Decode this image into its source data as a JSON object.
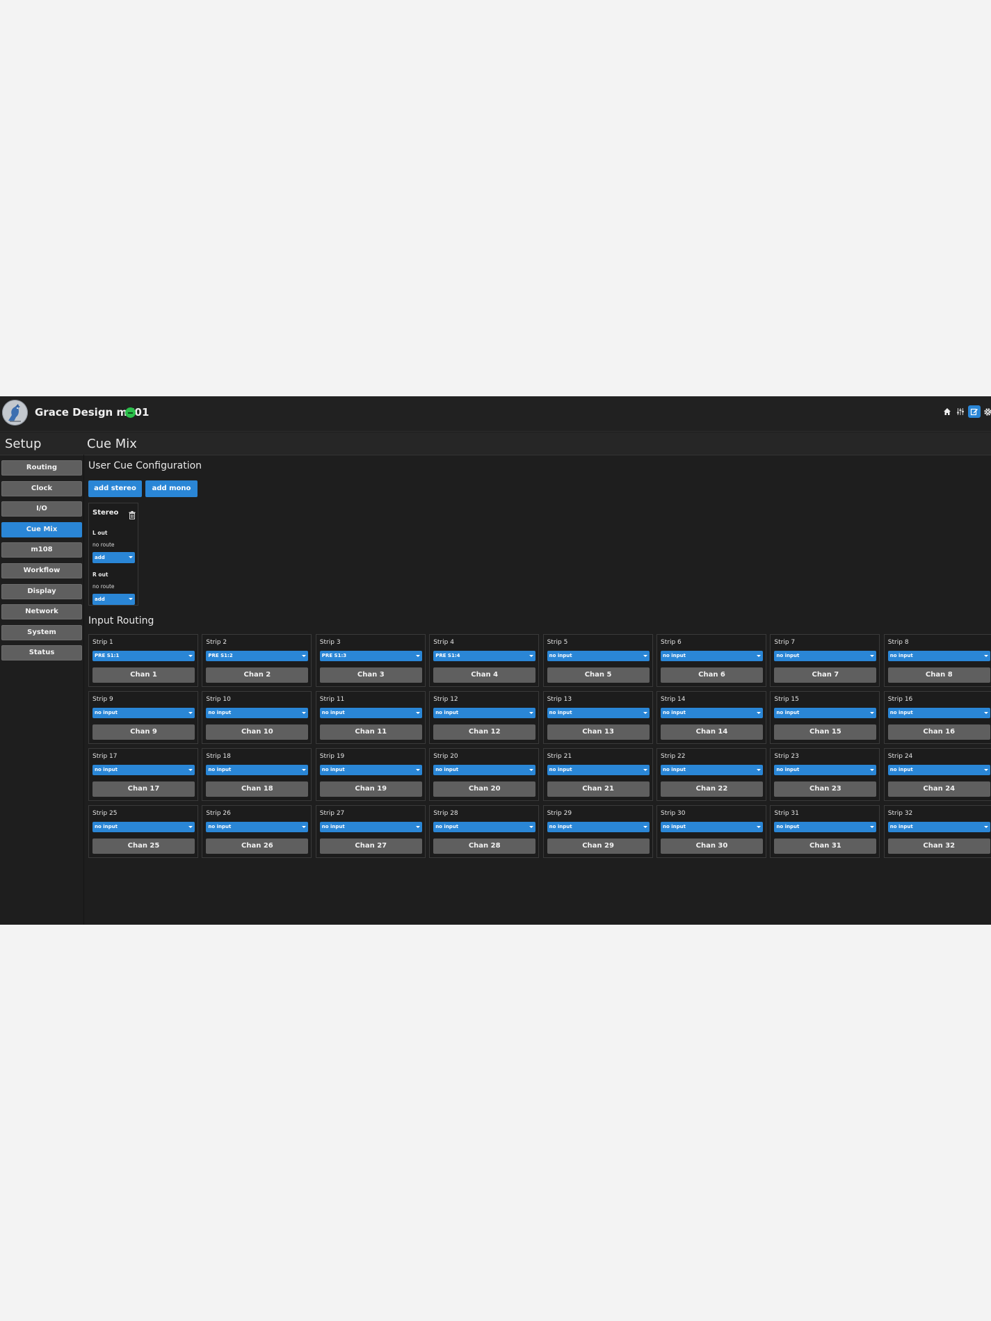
{
  "header": {
    "title": "Grace Design m701",
    "status_color": "#2bbf4b",
    "icons": [
      "home-icon",
      "mixer-icon",
      "edit-icon",
      "gear-icon"
    ]
  },
  "sidebar": {
    "title": "Setup",
    "items": [
      {
        "label": "Routing",
        "active": false
      },
      {
        "label": "Clock",
        "active": false
      },
      {
        "label": "I/O",
        "active": false
      },
      {
        "label": "Cue Mix",
        "active": true
      },
      {
        "label": "m108",
        "active": false
      },
      {
        "label": "Workflow",
        "active": false
      },
      {
        "label": "Display",
        "active": false
      },
      {
        "label": "Network",
        "active": false
      },
      {
        "label": "System",
        "active": false
      },
      {
        "label": "Status",
        "active": false
      }
    ]
  },
  "main": {
    "title": "Cue Mix",
    "cue_config": {
      "title": "User Cue Configuration",
      "add_stereo": "add stereo",
      "add_mono": "add mono",
      "stereo_card": {
        "title": "Stereo",
        "left": {
          "label": "L out",
          "route": "no route",
          "select": "add"
        },
        "right": {
          "label": "R out",
          "route": "no route",
          "select": "add"
        }
      }
    },
    "input_routing": {
      "title": "Input Routing",
      "strips": [
        {
          "name": "Strip 1",
          "input": "PRE S1:1",
          "chan": "Chan 1"
        },
        {
          "name": "Strip 2",
          "input": "PRE S1:2",
          "chan": "Chan 2"
        },
        {
          "name": "Strip 3",
          "input": "PRE S1:3",
          "chan": "Chan 3"
        },
        {
          "name": "Strip 4",
          "input": "PRE S1:4",
          "chan": "Chan 4"
        },
        {
          "name": "Strip 5",
          "input": "no input",
          "chan": "Chan 5"
        },
        {
          "name": "Strip 6",
          "input": "no input",
          "chan": "Chan 6"
        },
        {
          "name": "Strip 7",
          "input": "no input",
          "chan": "Chan 7"
        },
        {
          "name": "Strip 8",
          "input": "no input",
          "chan": "Chan 8"
        },
        {
          "name": "Strip 9",
          "input": "no input",
          "chan": "Chan 9"
        },
        {
          "name": "Strip 10",
          "input": "no input",
          "chan": "Chan 10"
        },
        {
          "name": "Strip 11",
          "input": "no input",
          "chan": "Chan 11"
        },
        {
          "name": "Strip 12",
          "input": "no input",
          "chan": "Chan 12"
        },
        {
          "name": "Strip 13",
          "input": "no input",
          "chan": "Chan 13"
        },
        {
          "name": "Strip 14",
          "input": "no input",
          "chan": "Chan 14"
        },
        {
          "name": "Strip 15",
          "input": "no input",
          "chan": "Chan 15"
        },
        {
          "name": "Strip 16",
          "input": "no input",
          "chan": "Chan 16"
        },
        {
          "name": "Strip 17",
          "input": "no input",
          "chan": "Chan 17"
        },
        {
          "name": "Strip 18",
          "input": "no input",
          "chan": "Chan 18"
        },
        {
          "name": "Strip 19",
          "input": "no input",
          "chan": "Chan 19"
        },
        {
          "name": "Strip 20",
          "input": "no input",
          "chan": "Chan 20"
        },
        {
          "name": "Strip 21",
          "input": "no input",
          "chan": "Chan 21"
        },
        {
          "name": "Strip 22",
          "input": "no input",
          "chan": "Chan 22"
        },
        {
          "name": "Strip 23",
          "input": "no input",
          "chan": "Chan 23"
        },
        {
          "name": "Strip 24",
          "input": "no input",
          "chan": "Chan 24"
        },
        {
          "name": "Strip 25",
          "input": "no input",
          "chan": "Chan 25"
        },
        {
          "name": "Strip 26",
          "input": "no input",
          "chan": "Chan 26"
        },
        {
          "name": "Strip 27",
          "input": "no input",
          "chan": "Chan 27"
        },
        {
          "name": "Strip 28",
          "input": "no input",
          "chan": "Chan 28"
        },
        {
          "name": "Strip 29",
          "input": "no input",
          "chan": "Chan 29"
        },
        {
          "name": "Strip 30",
          "input": "no input",
          "chan": "Chan 30"
        },
        {
          "name": "Strip 31",
          "input": "no input",
          "chan": "Chan 31"
        },
        {
          "name": "Strip 32",
          "input": "no input",
          "chan": "Chan 32"
        }
      ]
    }
  },
  "colors": {
    "accent": "#2a86d6",
    "button_gray": "#5f5f5f",
    "background": "#1e1e1e"
  }
}
